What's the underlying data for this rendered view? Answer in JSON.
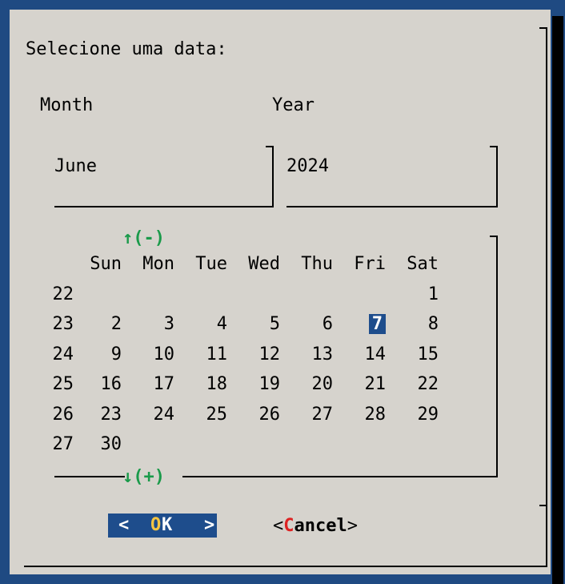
{
  "dialog": {
    "title": "Selecione uma data:"
  },
  "fields": {
    "month_label": "Month",
    "year_label": "Year",
    "month_value": "June",
    "year_value": "2024"
  },
  "calendar": {
    "nav_up": "↑(-)",
    "nav_down": "↓(+)",
    "weekdays": [
      "Sun",
      "Mon",
      "Tue",
      "Wed",
      "Thu",
      "Fri",
      "Sat"
    ],
    "weeks": [
      {
        "week": "22",
        "days": [
          "",
          "",
          "",
          "",
          "",
          "",
          "1"
        ]
      },
      {
        "week": "23",
        "days": [
          "2",
          "3",
          "4",
          "5",
          "6",
          "7",
          "8"
        ]
      },
      {
        "week": "24",
        "days": [
          "9",
          "10",
          "11",
          "12",
          "13",
          "14",
          "15"
        ]
      },
      {
        "week": "25",
        "days": [
          "16",
          "17",
          "18",
          "19",
          "20",
          "21",
          "22"
        ]
      },
      {
        "week": "26",
        "days": [
          "23",
          "24",
          "25",
          "26",
          "27",
          "28",
          "29"
        ]
      },
      {
        "week": "27",
        "days": [
          "30",
          "",
          "",
          "",
          "",
          "",
          ""
        ]
      }
    ],
    "selected_day": "7"
  },
  "buttons": {
    "ok_left": "<",
    "ok_hotkey": "O",
    "ok_rest": "K",
    "ok_right": ">",
    "cancel_open": "<",
    "cancel_hotkey": "C",
    "cancel_rest": "ancel",
    "cancel_close": ">"
  },
  "colors": {
    "background": "#1f4a82",
    "dialog": "#d6d3cd",
    "accent": "#1e4d8c",
    "nav": "#1a9a4a",
    "hotkey_cancel": "#dd2222",
    "hotkey_ok": "#f5c542"
  }
}
